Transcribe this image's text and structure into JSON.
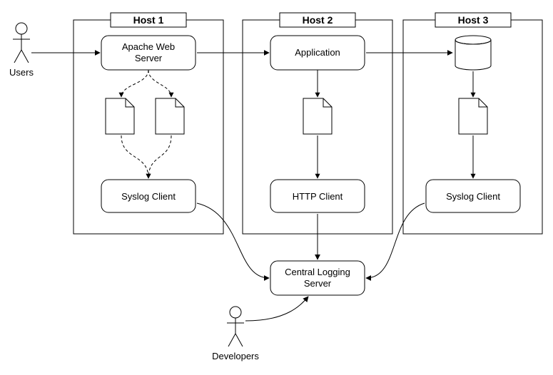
{
  "hosts": {
    "host1": {
      "title": "Host 1",
      "top_node": "Apache Web\nServer",
      "bottom_node": "Syslog Client"
    },
    "host2": {
      "title": "Host 2",
      "top_node": "Application",
      "bottom_node": "HTTP Client"
    },
    "host3": {
      "title": "Host 3",
      "top_node": "",
      "bottom_node": "Syslog Client"
    }
  },
  "central": {
    "label": "Central Logging\nServer"
  },
  "actors": {
    "users": "Users",
    "developers": "Developers"
  },
  "colors": {
    "stroke": "#000000",
    "fill": "#ffffff"
  }
}
